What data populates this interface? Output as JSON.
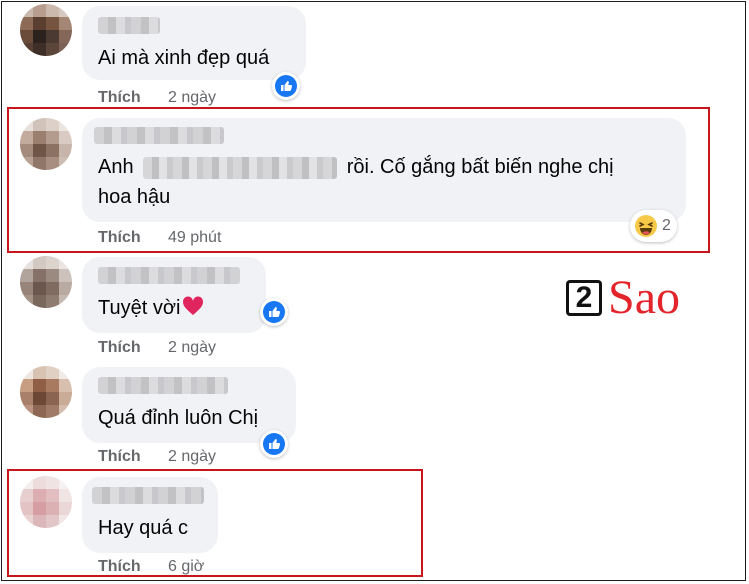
{
  "logo": {
    "digit": "2",
    "word": "Sao"
  },
  "comments": [
    {
      "text": "Ai mà xinh đẹp quá",
      "action": "Thích",
      "time": "2 ngày",
      "reaction": "like-icon"
    },
    {
      "text_start": "Anh",
      "text_end": "rồi. Cố gắng bất biến nghe chị",
      "text_line2": "hoa hậu",
      "action": "Thích",
      "time": "49 phút",
      "reaction": "haha-icon",
      "reaction_count": "2"
    },
    {
      "text": "Tuyệt vời",
      "action": "Thích",
      "time": "2 ngày",
      "reaction": "like-icon"
    },
    {
      "text": "Quá đỉnh luôn Chị",
      "action": "Thích",
      "time": "2 ngày",
      "reaction": "like-icon"
    },
    {
      "text": "Hay quá c",
      "action": "Thích",
      "time": "6 giờ"
    }
  ],
  "colors": {
    "highlight": "#c8161d",
    "like_blue": "#1877f2",
    "bubble": "#f0f2f5",
    "meta_gray": "#65676b"
  }
}
